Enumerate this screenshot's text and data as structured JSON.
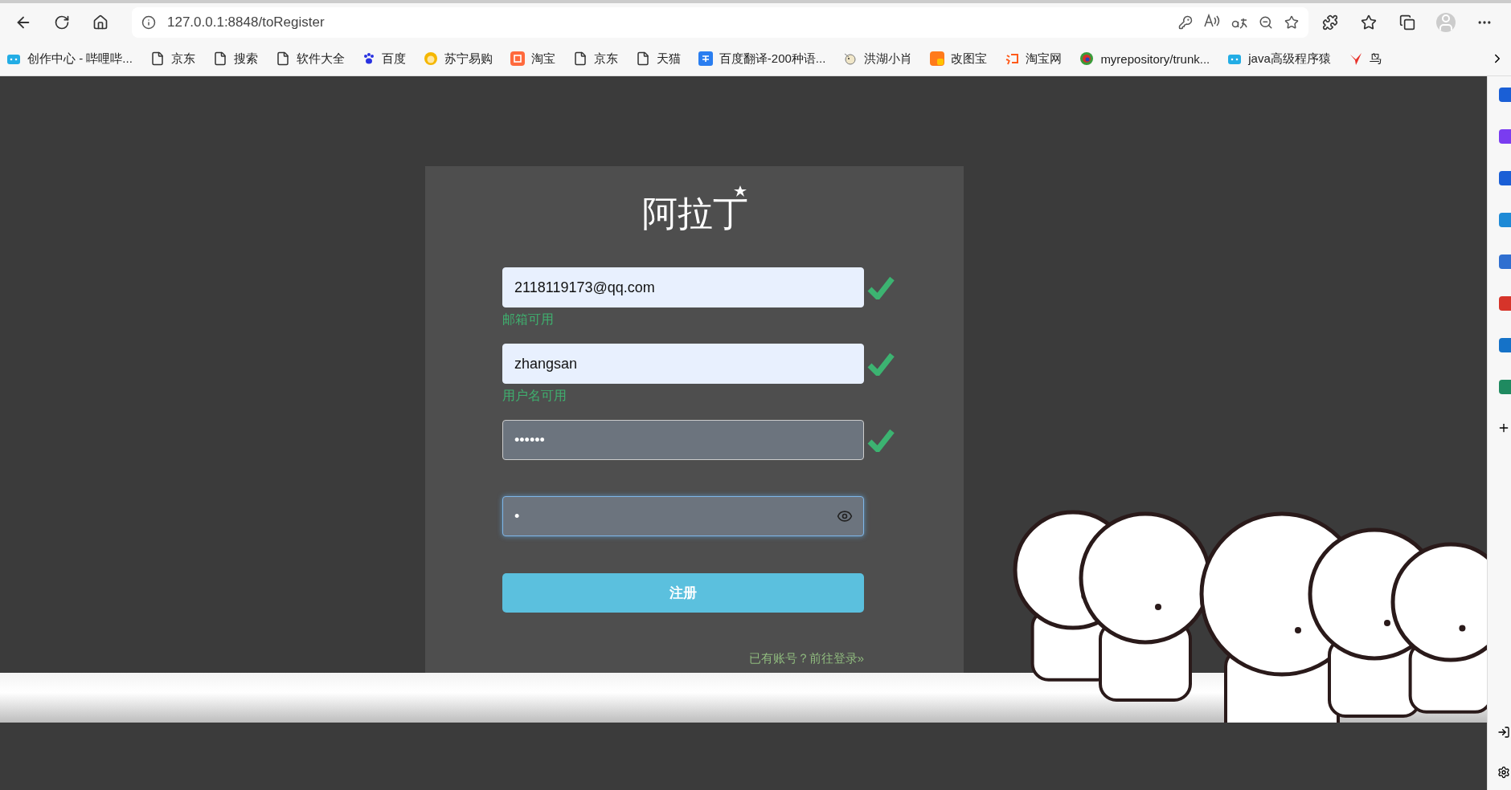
{
  "browser": {
    "url": "127.0.0.1:8848/toRegister"
  },
  "bookmarks": [
    {
      "label": "创作中心 - 哔哩哔...",
      "kind": "tv"
    },
    {
      "label": "京东",
      "kind": "page"
    },
    {
      "label": "搜索",
      "kind": "page"
    },
    {
      "label": "软件大全",
      "kind": "page"
    },
    {
      "label": "百度",
      "kind": "paw"
    },
    {
      "label": "苏宁易购",
      "kind": "lion"
    },
    {
      "label": "淘宝",
      "kind": "tao"
    },
    {
      "label": "京东",
      "kind": "page"
    },
    {
      "label": "天猫",
      "kind": "page"
    },
    {
      "label": "百度翻译-200种语...",
      "kind": "translate"
    },
    {
      "label": "洪湖小肖",
      "kind": "mascot"
    },
    {
      "label": "改图宝",
      "kind": "square"
    },
    {
      "label": "淘宝网",
      "kind": "taotext"
    },
    {
      "label": "myrepository/trunk...",
      "kind": "circle"
    },
    {
      "label": "java高级程序猿",
      "kind": "tv"
    },
    {
      "label": "鸟",
      "kind": "bird"
    }
  ],
  "register_form": {
    "logo": "阿拉丁",
    "fields": [
      {
        "kind": "filled",
        "value": "2118119173@qq.com",
        "valid": true,
        "hint": "邮箱可用",
        "focused": false,
        "reveal": false
      },
      {
        "kind": "filled",
        "value": "zhangsan",
        "valid": true,
        "hint": "用户名可用",
        "focused": false,
        "reveal": false
      },
      {
        "kind": "secret",
        "value": "••••••",
        "valid": true,
        "focused": false,
        "reveal": false
      },
      {
        "kind": "secret",
        "value": "•",
        "valid": false,
        "focused": true,
        "reveal": true
      }
    ],
    "submit": "注册",
    "login_link": "已有账号？前往登录»"
  }
}
